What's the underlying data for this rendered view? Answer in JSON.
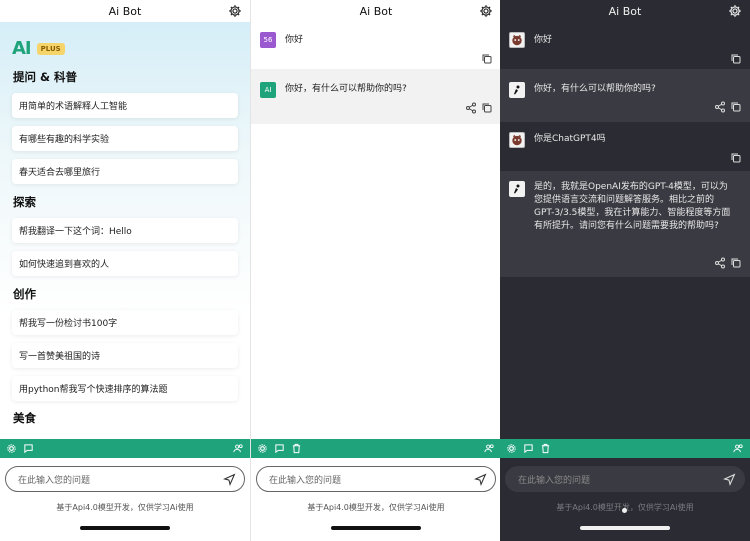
{
  "app": {
    "title": "Ai Bot",
    "brand_ai": "AI",
    "brand_plus": "PLUS"
  },
  "home": {
    "sections": [
      {
        "title": "提问 & 科普",
        "items": [
          "用简单的术语解释人工智能",
          "有哪些有趣的科学实验",
          "春天适合去哪里旅行"
        ]
      },
      {
        "title": "探索",
        "items": [
          "帮我翻译一下这个词：Hello",
          "如何快速追到喜欢的人"
        ]
      },
      {
        "title": "创作",
        "items": [
          "帮我写一份检讨书100字",
          "写一首赞美祖国的诗",
          "用python帮我写个快速排序的算法题"
        ]
      },
      {
        "title": "美食",
        "items": []
      }
    ]
  },
  "chat_light": {
    "user_avatar": "56",
    "bot_avatar": "AI",
    "messages": [
      "你好",
      "你好，有什么可以帮助你的吗?"
    ]
  },
  "chat_dark": {
    "messages": [
      "你好",
      "你好，有什么可以帮助你的吗?",
      "你是ChatGPT4吗",
      "是的，我就是OpenAI发布的GPT-4模型，可以为您提供语言交流和问题解答服务。相比之前的GPT-3/3.5模型，我在计算能力、智能程度等方面有所提升。请问您有什么问题需要我的帮助吗?"
    ]
  },
  "composer": {
    "placeholder": "在此输入您的问题",
    "footnote": "基于Api4.0模型开发，仅供学习Ai使用"
  },
  "colors": {
    "accent": "#1fa37a",
    "dark_bg": "#2b2b33",
    "user_avatar_bg": "#9b59d0"
  }
}
